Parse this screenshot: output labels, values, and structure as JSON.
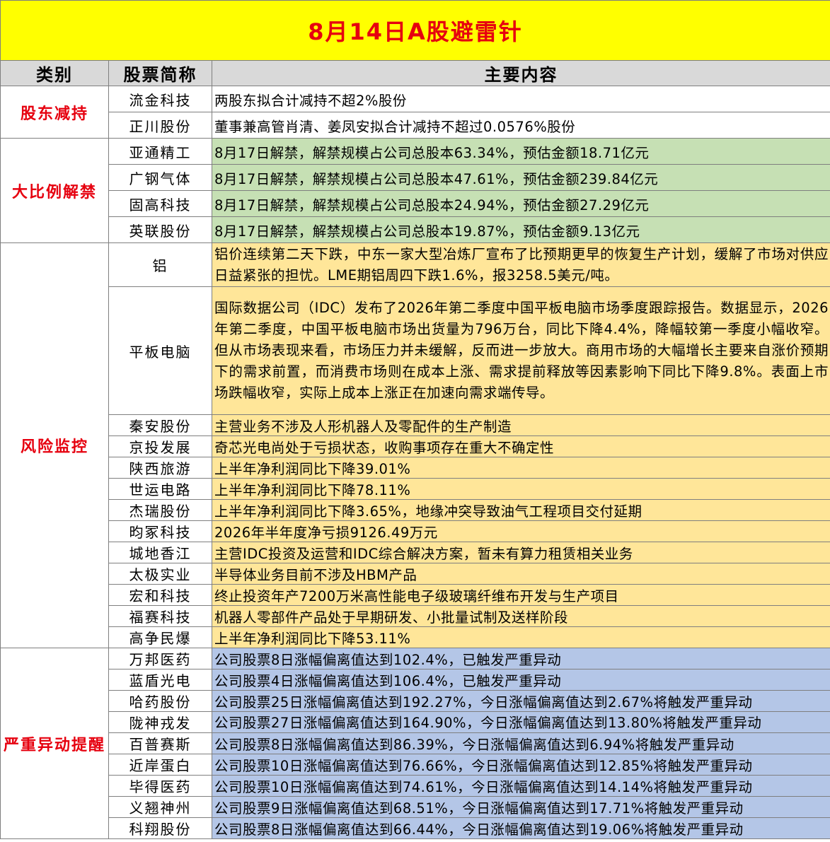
{
  "title": "8月14日A股避雷针",
  "headers": {
    "category": "类别",
    "stock": "股票简称",
    "content": "主要内容"
  },
  "groups": [
    {
      "category": "股东减持",
      "color": "g-white",
      "rows": [
        {
          "stock": "流金科技",
          "content": "两股东拟合计减持不超2%股份"
        },
        {
          "stock": "正川股份",
          "content": "董事兼高管肖清、姜凤安拟合计减持不超过0.0576%股份"
        }
      ]
    },
    {
      "category": "大比例解禁",
      "rows": [
        {
          "stock": "亚通精工",
          "content": "8月17日解禁，解禁规模占公司总股本63.34%，预估金额18.71亿元"
        },
        {
          "stock": "广钢气体",
          "content": "8月17日解禁，解禁规模占公司总股本47.61%，预估金额239.84亿元"
        },
        {
          "stock": "固高科技",
          "content": "8月17日解禁，解禁规模占公司总股本24.94%，预估金额27.29亿元"
        },
        {
          "stock": "英联股份",
          "content": "8月17日解禁，解禁规模占公司总股本19.87%，预估金额9.13亿元"
        }
      ]
    },
    {
      "category": "风险监控",
      "rows": [
        {
          "stock": "铝",
          "content": "铝价连续第二天下跌，中东一家大型冶炼厂宣布了比预期更早的恢复生产计划，缓解了市场对供应日益紧张的担忧。LME期铝周四下跌1.6%，报3258.5美元/吨。"
        },
        {
          "stock": "平板电脑",
          "content": "国际数据公司（IDC）发布了2026年第二季度中国平板电脑市场季度跟踪报告。数据显示，2026年第二季度，中国平板电脑市场出货量为796万台，同比下降4.4%，降幅较第一季度小幅收窄。但从市场表现来看，市场压力并未缓解，反而进一步放大。商用市场的大幅增长主要来自涨价预期下的需求前置，而消费市场则在成本上涨、需求提前释放等因素影响下同比下降9.8%。表面上市场跌幅收窄，实际上成本上涨正在加速向需求端传导。"
        },
        {
          "stock": "秦安股份",
          "content": "主营业务不涉及人形机器人及零配件的生产制造"
        },
        {
          "stock": "京投发展",
          "content": "奇芯光电尚处于亏损状态，收购事项存在重大不确定性"
        },
        {
          "stock": "陕西旅游",
          "content": "上半年净利润同比下降39.01%"
        },
        {
          "stock": "世运电路",
          "content": "上半年净利润同比下降78.11%"
        },
        {
          "stock": "杰瑞股份",
          "content": "上半年净利润同比下降3.65%，地缘冲突导致油气工程项目交付延期"
        },
        {
          "stock": "昀冢科技",
          "content": "2026年半年度净亏损9126.49万元"
        },
        {
          "stock": "城地香江",
          "content": "主营IDC投资及运营和IDC综合解决方案，暂未有算力租赁相关业务"
        },
        {
          "stock": "太极实业",
          "content": "半导体业务目前不涉及HBM产品"
        },
        {
          "stock": "宏和科技",
          "content": "终止投资年产7200万米高性能电子级玻璃纤维布开发与生产项目"
        },
        {
          "stock": "福赛科技",
          "content": "机器人零部件产品处于早期研发、小批量试制及送样阶段"
        },
        {
          "stock": "高争民爆",
          "content": "上半年净利润同比下降53.11%"
        }
      ]
    },
    {
      "category": "严重异动提醒",
      "rows": [
        {
          "stock": "万邦医药",
          "content": "公司股票8日涨幅偏离值达到102.4%，已触发严重异动"
        },
        {
          "stock": "蓝盾光电",
          "content": "公司股票4日涨幅偏离值达到106.4%，已触发严重异动"
        },
        {
          "stock": "哈药股份",
          "content": "公司股票25日涨幅偏离值达到192.27%，今日涨幅偏离值达到2.67%将触发严重异动"
        },
        {
          "stock": "陇神戎发",
          "content": "公司股票27日涨幅偏离值达到164.90%，今日涨幅偏离值达到13.80%将触发严重异动"
        },
        {
          "stock": "百普赛斯",
          "content": "公司股票8日涨幅偏离值达到86.39%，今日涨幅偏离值达到6.94%将触发严重异动"
        },
        {
          "stock": "近岸蛋白",
          "content": "公司股票10日涨幅偏离值达到76.66%，今日涨幅偏离值达到12.85%将触发严重异动"
        },
        {
          "stock": "毕得医药",
          "content": "公司股票10日涨幅偏离值达到74.61%，今日涨幅偏离值达到14.14%将触发严重异动"
        },
        {
          "stock": "义翘神州",
          "content": "公司股票9日涨幅偏离值达到68.51%，今日涨幅偏离值达到17.71%将触发严重异动"
        },
        {
          "stock": "科翔股份",
          "content": "公司股票8日涨幅偏离值达到66.44%，今日涨幅偏离值达到19.06%将触发严重异动"
        }
      ]
    }
  ],
  "colors": {
    "title_bg": "#ffff00",
    "title_text": "#e6000f",
    "header_bg": "#d9d9d9",
    "green": "#c6e0b4",
    "yellow": "#ffe699",
    "blue": "#b4c6e7"
  }
}
